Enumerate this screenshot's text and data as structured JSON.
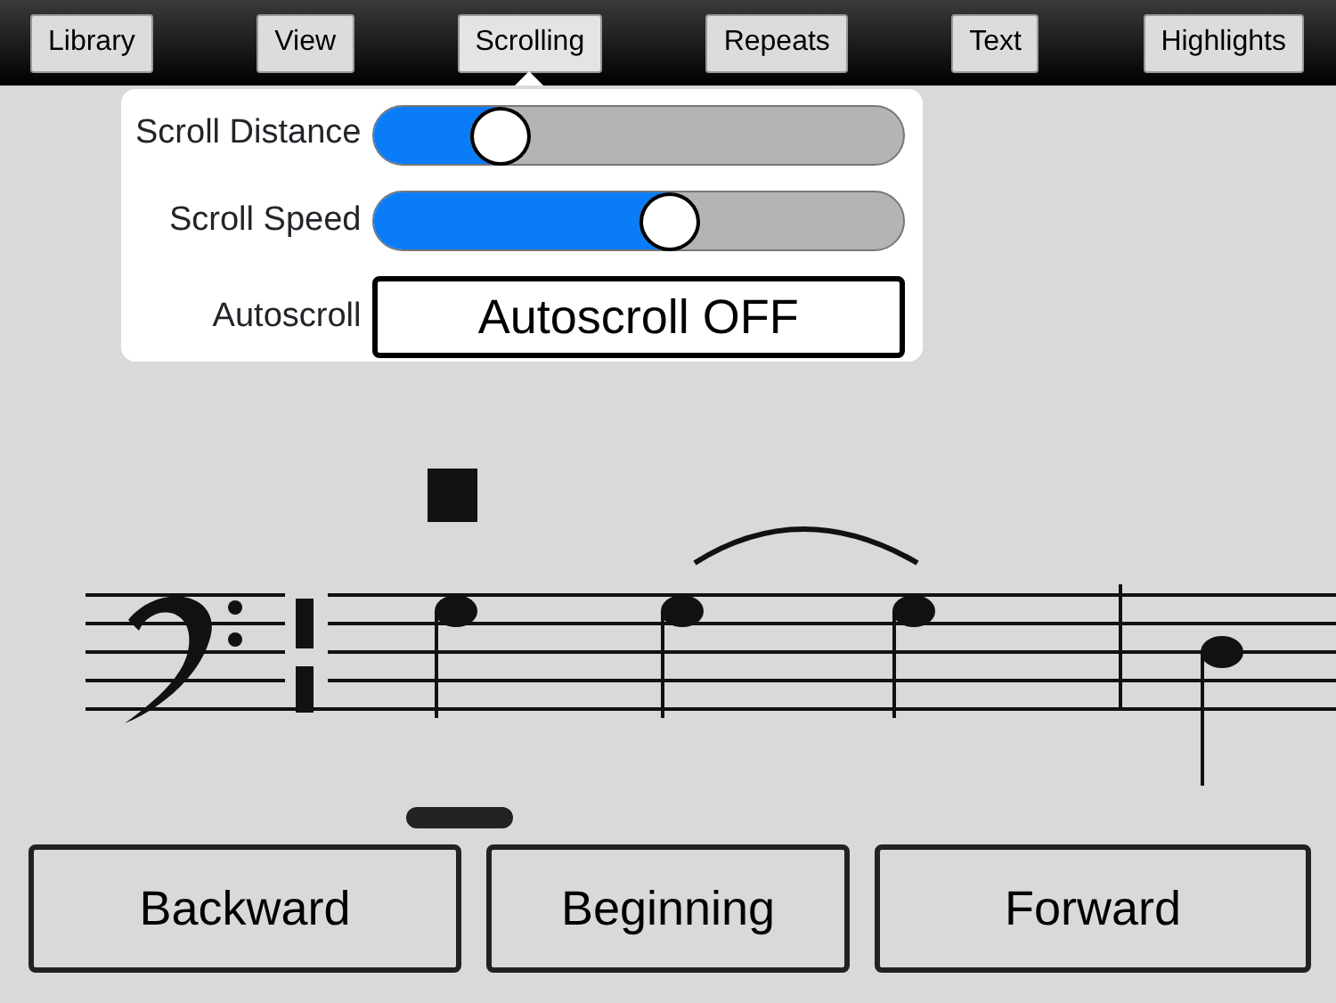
{
  "toolbar": [
    {
      "label": "Library",
      "selected": false
    },
    {
      "label": "View",
      "selected": false
    },
    {
      "label": "Scrolling",
      "selected": true
    },
    {
      "label": "Repeats",
      "selected": false
    },
    {
      "label": "Text",
      "selected": false
    },
    {
      "label": "Highlights",
      "selected": false
    }
  ],
  "popover": {
    "sliders": [
      {
        "label": "Scroll Distance",
        "level": 0.24
      },
      {
        "label": "Scroll Speed",
        "level": 0.56
      }
    ],
    "autoscroll": {
      "label": "Autoscroll",
      "button": "Autoscroll OFF"
    }
  },
  "buttons": [
    "Backward",
    "Beginning",
    "Forward"
  ]
}
